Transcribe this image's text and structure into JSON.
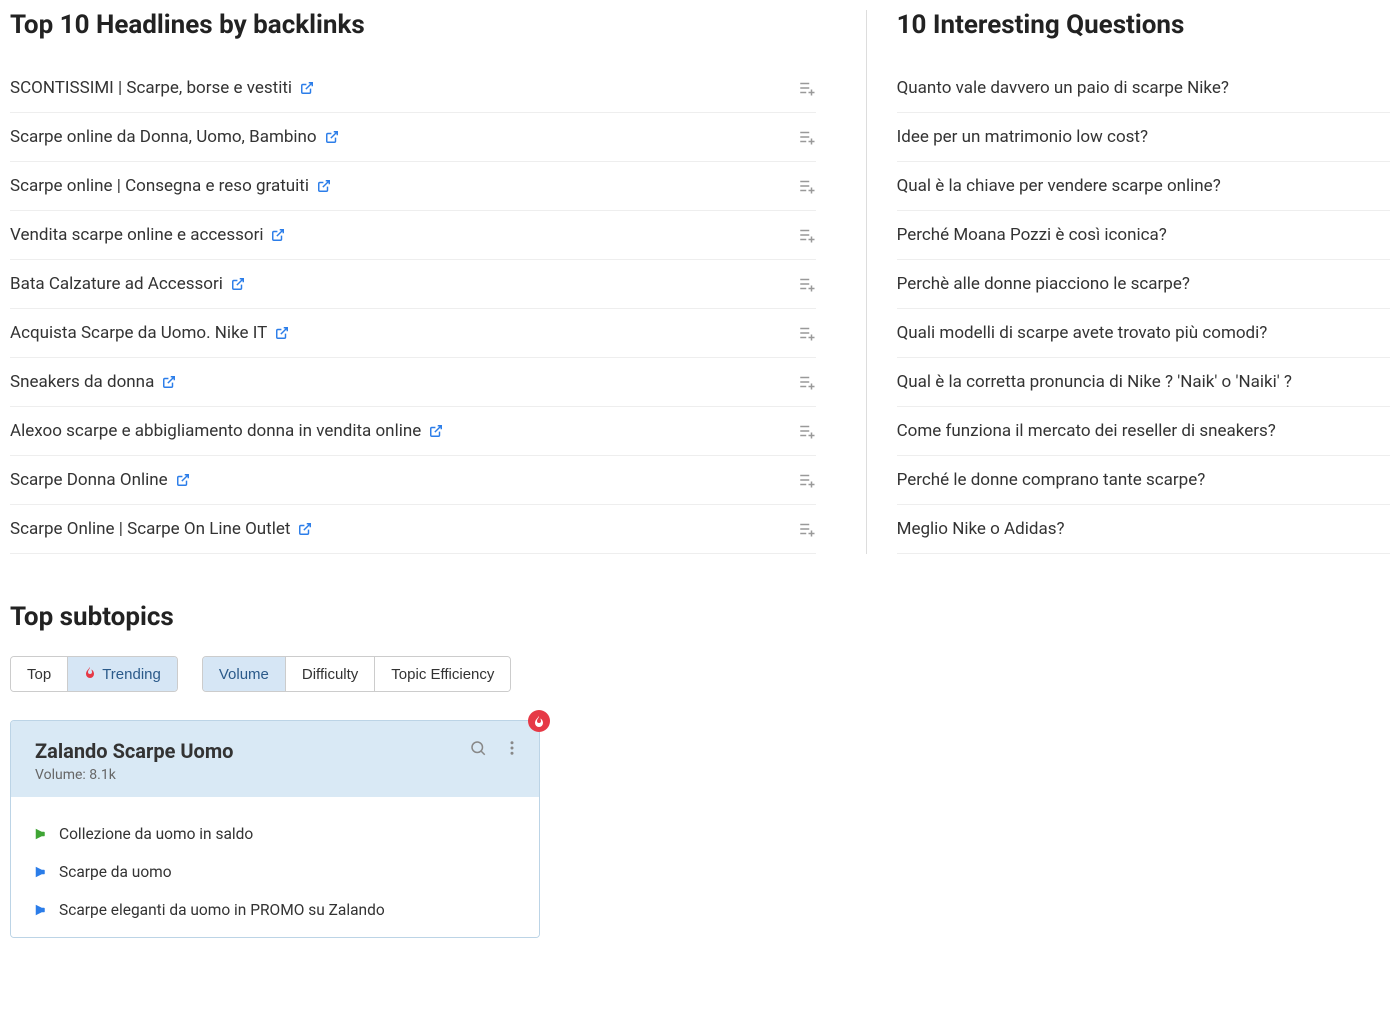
{
  "headlines": {
    "title": "Top 10 Headlines by backlinks",
    "items": [
      "SCONTISSIMI | Scarpe, borse e vestiti",
      "Scarpe online da Donna, Uomo, Bambino",
      "Scarpe online | Consegna e reso gratuiti",
      "Vendita scarpe online e accessori",
      "Bata Calzature ad Accessori",
      "Acquista Scarpe da Uomo. Nike IT",
      "Sneakers da donna",
      "Alexoo scarpe e abbigliamento donna in vendita online",
      "Scarpe Donna Online",
      "Scarpe Online | Scarpe On Line Outlet"
    ]
  },
  "questions": {
    "title": "10 Interesting Questions",
    "items": [
      "Quanto vale davvero un paio di scarpe Nike?",
      "Idee per un matrimonio low cost?",
      "Qual è la chiave per vendere scarpe online?",
      "Perché Moana Pozzi è così iconica?",
      "Perchè alle donne piacciono le scarpe?",
      "Quali modelli di scarpe avete trovato più comodi?",
      "Qual è la corretta pronuncia di Nike ? 'Naik' o 'Naiki' ?",
      "Come funziona il mercato dei reseller di sneakers?",
      "Perché le donne comprano tante scarpe?",
      "Meglio Nike o Adidas?"
    ]
  },
  "subtopics": {
    "title": "Top subtopics",
    "tabs1": {
      "top": "Top",
      "trending": "Trending"
    },
    "tabs2": {
      "volume": "Volume",
      "difficulty": "Difficulty",
      "efficiency": "Topic Efficiency"
    },
    "card": {
      "title": "Zalando Scarpe Uomo",
      "volume_label": "Volume:",
      "volume_value": "8.1k",
      "items": [
        {
          "text": "Collezione da uomo in saldo",
          "color": "green"
        },
        {
          "text": "Scarpe da uomo",
          "color": "blue"
        },
        {
          "text": "Scarpe eleganti da uomo in PROMO su Zalando",
          "color": "blue"
        }
      ]
    }
  }
}
